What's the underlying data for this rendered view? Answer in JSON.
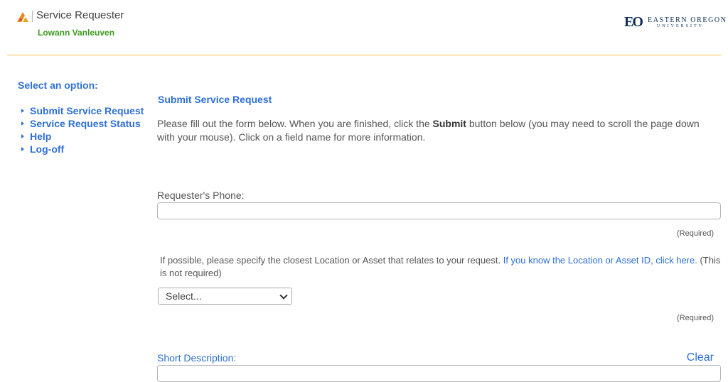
{
  "header": {
    "app_title": "Service Requester",
    "user_name": "Lowann Vanleuven",
    "university_line1": "EASTERN OREGON",
    "university_line2": "UNIVERSITY",
    "university_mark": "EO"
  },
  "sidebar": {
    "heading": "Select an option:",
    "items": [
      {
        "label": "Submit Service Request"
      },
      {
        "label": "Service Request Status"
      },
      {
        "label": "Help"
      },
      {
        "label": "Log-off"
      }
    ]
  },
  "main": {
    "title": "Submit Service Request",
    "intro_before": "Please fill out the form below. When you are finished, click the ",
    "intro_bold": "Submit",
    "intro_after": " button below (you may need to scroll the page down with your mouse). Click on a field name for more information.",
    "phone_label": "Requester's Phone:",
    "phone_value": "",
    "required_1": "(Required)",
    "location_text_before": "If possible, please specify the closest Location or Asset that relates to your request. ",
    "location_link": "If you know the Location or Asset ID, click here.",
    "location_text_after": " (This is not required)",
    "select_value": "Select...",
    "required_2": "(Required)",
    "short_desc_label": "Short Description:",
    "clear_label": "Clear"
  },
  "colors": {
    "accent_blue": "#2e6fd6",
    "user_green": "#3c9a1f",
    "divider_gold": "#f0c24a"
  }
}
